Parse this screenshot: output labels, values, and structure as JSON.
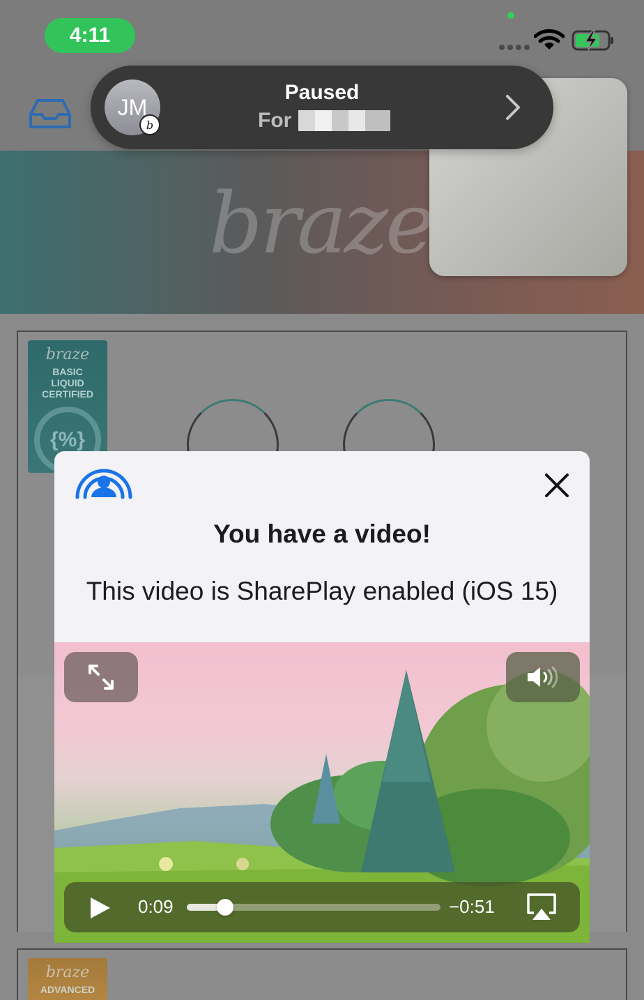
{
  "status_bar": {
    "time": "4:11"
  },
  "shareplay_pill": {
    "avatar_initials": "JM",
    "avatar_badge": "b",
    "title": "Paused",
    "subtitle": "For"
  },
  "background": {
    "banner_brand": "braze",
    "badge_1": {
      "brand": "braze",
      "lines": [
        "BASIC",
        "LIQUID",
        "CERTIFIED"
      ],
      "symbol": "{%}"
    },
    "badge_2": {
      "brand": "braze",
      "lines": [
        "ADVANCED"
      ]
    }
  },
  "modal": {
    "title": "You have a video!",
    "body": "This video is SharePlay enabled (iOS 15)"
  },
  "video": {
    "elapsed": "0:09",
    "remaining": "−0:51",
    "progress": 0.15
  },
  "colors": {
    "time_pill": "#32c45a",
    "shareplay_accent": "#1a73e8",
    "modal_bg": "#f2f2f7"
  }
}
